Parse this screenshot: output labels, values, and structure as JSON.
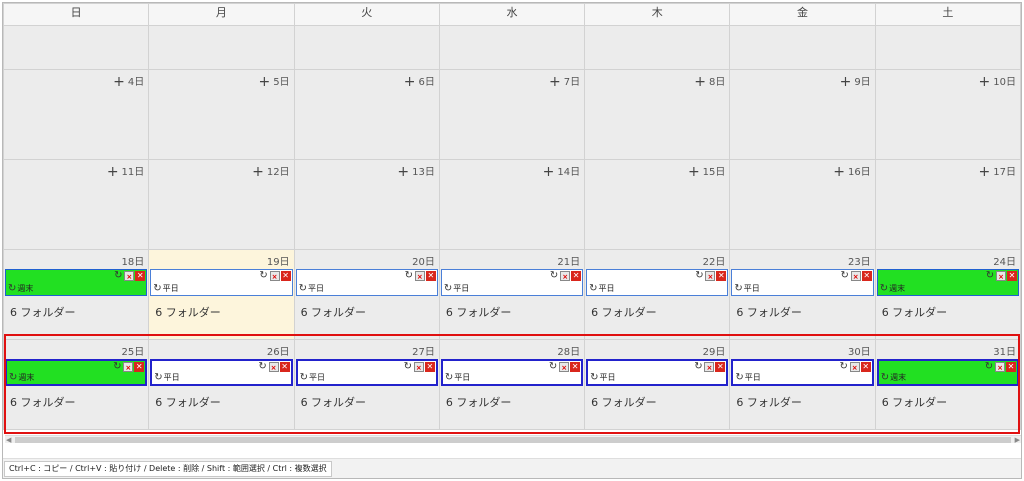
{
  "weekdays": [
    "日",
    "月",
    "火",
    "水",
    "木",
    "金",
    "土"
  ],
  "weeks": [
    {
      "days": [
        {
          "label": "",
          "plus": false
        },
        {
          "label": "",
          "plus": false
        },
        {
          "label": "",
          "plus": false
        },
        {
          "label": "",
          "plus": false
        },
        {
          "label": "",
          "plus": false
        },
        {
          "label": "",
          "plus": false
        },
        {
          "label": "",
          "plus": false
        }
      ]
    },
    {
      "days": [
        {
          "label": "4日",
          "plus": true
        },
        {
          "label": "5日",
          "plus": true
        },
        {
          "label": "6日",
          "plus": true
        },
        {
          "label": "7日",
          "plus": true
        },
        {
          "label": "8日",
          "plus": true
        },
        {
          "label": "9日",
          "plus": true
        },
        {
          "label": "10日",
          "plus": true
        }
      ]
    },
    {
      "days": [
        {
          "label": "11日",
          "plus": true
        },
        {
          "label": "12日",
          "plus": true
        },
        {
          "label": "13日",
          "plus": true
        },
        {
          "label": "14日",
          "plus": true
        },
        {
          "label": "15日",
          "plus": true
        },
        {
          "label": "16日",
          "plus": true
        },
        {
          "label": "17日",
          "plus": true
        }
      ]
    },
    {
      "days": [
        {
          "label": "18日",
          "schedule": "週末",
          "weekend": true,
          "folder": "6 フォルダー"
        },
        {
          "label": "19日",
          "schedule": "平日",
          "weekend": false,
          "folder": "6 フォルダー",
          "today": true
        },
        {
          "label": "20日",
          "schedule": "平日",
          "weekend": false,
          "folder": "6 フォルダー"
        },
        {
          "label": "21日",
          "schedule": "平日",
          "weekend": false,
          "folder": "6 フォルダー"
        },
        {
          "label": "22日",
          "schedule": "平日",
          "weekend": false,
          "folder": "6 フォルダー"
        },
        {
          "label": "23日",
          "schedule": "平日",
          "weekend": false,
          "folder": "6 フォルダー"
        },
        {
          "label": "24日",
          "schedule": "週末",
          "weekend": true,
          "folder": "6 フォルダー"
        }
      ]
    },
    {
      "selected": true,
      "days": [
        {
          "label": "25日",
          "schedule": "週末",
          "weekend": true,
          "folder": "6 フォルダー"
        },
        {
          "label": "26日",
          "schedule": "平日",
          "weekend": false,
          "folder": "6 フォルダー"
        },
        {
          "label": "27日",
          "schedule": "平日",
          "weekend": false,
          "folder": "6 フォルダー"
        },
        {
          "label": "28日",
          "schedule": "平日",
          "weekend": false,
          "folder": "6 フォルダー"
        },
        {
          "label": "29日",
          "schedule": "平日",
          "weekend": false,
          "folder": "6 フォルダー"
        },
        {
          "label": "30日",
          "schedule": "平日",
          "weekend": false,
          "folder": "6 フォルダー"
        },
        {
          "label": "31日",
          "schedule": "週末",
          "weekend": true,
          "folder": "6 フォルダー"
        }
      ]
    }
  ],
  "icons": {
    "add": "+",
    "repeat": "↻",
    "exclude": "除外",
    "delete": "✕"
  },
  "colors": {
    "weekend_schedule": "#22e022",
    "selection_outline": "#e01010",
    "today_background": "#fdf5dc"
  },
  "shortcut_hint": "Ctrl+C : コピー / Ctrl+V : 貼り付け / Delete : 削除 / Shift : 範囲選択 / Ctrl : 複数選択"
}
